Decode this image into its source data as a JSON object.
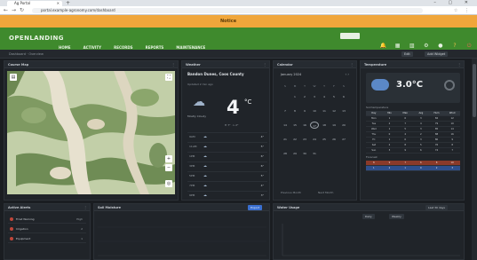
{
  "browser": {
    "tab_label": "Ag Portal",
    "url": "portal.example-agronomy.com/dashboard",
    "window_controls": "– ▢ ✕"
  },
  "banner": {
    "text": "Notice"
  },
  "app": {
    "logo": "OPENLANDING",
    "nav": [
      "HOME",
      "ACTIVITY",
      "RECORDS",
      "REPORTS",
      "MAINTENANCE"
    ],
    "header_icons": [
      {
        "icon": "bell-icon",
        "label": "Alerts"
      },
      {
        "icon": "calendar-icon",
        "label": "Calendar"
      },
      {
        "icon": "chart-icon",
        "label": "Reports"
      },
      {
        "icon": "gear-icon",
        "label": "Settings"
      },
      {
        "icon": "user-icon",
        "label": "Account"
      }
    ]
  },
  "subbar": {
    "left": "Dashboard · Overview",
    "btn_1": "Edit",
    "btn_2": "Add Widget"
  },
  "panels": {
    "map": {
      "title": "Course Map"
    },
    "weather": {
      "title": "Weather",
      "location": "Bandon Dunes, Coos County",
      "subtitle": "Updated 2 min ago",
      "condition": "Mostly Cloudy",
      "temp": "4",
      "unit": "°C",
      "hilo": "H 7° · L 2°",
      "rows": [
        {
          "time": "9AM",
          "val": "4°"
        },
        {
          "time": "11AM",
          "val": "5°"
        },
        {
          "time": "1PM",
          "val": "6°"
        },
        {
          "time": "3PM",
          "val": "6°"
        },
        {
          "time": "5PM",
          "val": "5°"
        },
        {
          "time": "7PM",
          "val": "4°"
        },
        {
          "time": "9PM",
          "val": "3°"
        }
      ]
    },
    "calendar": {
      "title": "Calendar",
      "month": "January 2024",
      "dow": [
        "S",
        "M",
        "T",
        "W",
        "T",
        "F",
        "S"
      ],
      "days": [
        "",
        "1",
        "2",
        "3",
        "4",
        "5",
        "6",
        "7",
        "8",
        "9",
        "10",
        "11",
        "12",
        "13",
        "14",
        "15",
        "16",
        "17",
        "18",
        "19",
        "20",
        "21",
        "22",
        "23",
        "24",
        "25",
        "26",
        "27",
        "28",
        "29",
        "30",
        "31",
        "",
        "",
        ""
      ],
      "today": "17",
      "foot_left": "Previous Month",
      "foot_right": "Next Month"
    },
    "temperature": {
      "title": "Temperature",
      "temp": "3.0°C",
      "table_label": "Soil temperature",
      "header": [
        "Day",
        "Min",
        "Max",
        "Avg",
        "Hum",
        "Wind"
      ],
      "rows": [
        [
          "Mon",
          "1",
          "6",
          "3",
          "82",
          "12"
        ],
        [
          "Tue",
          "2",
          "7",
          "4",
          "79",
          "10"
        ],
        [
          "Wed",
          "1",
          "5",
          "3",
          "85",
          "14"
        ],
        [
          "Thu",
          "0",
          "4",
          "2",
          "88",
          "16"
        ],
        [
          "Fri",
          "1",
          "6",
          "3",
          "80",
          "9"
        ],
        [
          "Sat",
          "2",
          "8",
          "5",
          "76",
          "8"
        ],
        [
          "Sun",
          "3",
          "9",
          "6",
          "74",
          "7"
        ]
      ],
      "footer_label": "Forecast",
      "forecast_hi": [
        "8",
        "9",
        "7",
        "6",
        "8",
        "10"
      ],
      "forecast_lo": [
        "1",
        "2",
        "1",
        "0",
        "2",
        "3"
      ]
    },
    "alerts": {
      "title": "Active Alerts",
      "items": [
        {
          "label": "Frost Warning",
          "val": "High"
        },
        {
          "label": "Irrigation",
          "val": "2"
        },
        {
          "label": "Equipment",
          "val": "1"
        }
      ]
    },
    "moisture": {
      "title": "Soil Moisture",
      "button": "Export"
    },
    "usage": {
      "title": "Water Usage",
      "filter": "Last 30 days",
      "btn_1": "Daily",
      "btn_2": "Weekly"
    }
  }
}
